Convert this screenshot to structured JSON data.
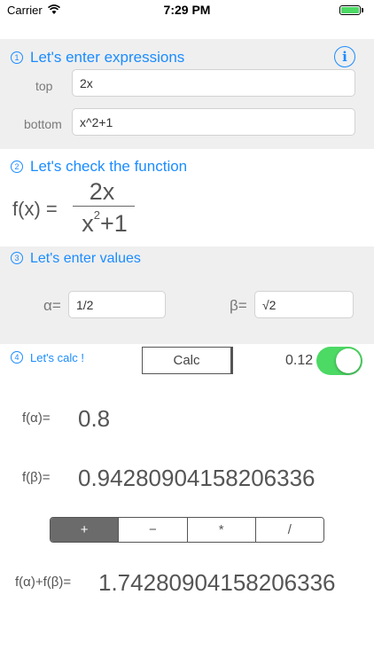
{
  "status_bar": {
    "carrier": "Carrier",
    "time": "7:29 PM"
  },
  "section1": {
    "num": "1",
    "title": "Let's enter expressions",
    "info_icon": "i",
    "top_label": "top",
    "top_value": "2x",
    "bottom_label": "bottom",
    "bottom_value": "x^2+1"
  },
  "section2": {
    "num": "2",
    "title": "Let's check the function",
    "fx_label": "f(x) =",
    "numerator": "2x",
    "denominator_base": "x",
    "denominator_exp": "2",
    "denominator_rest": "+1"
  },
  "section3": {
    "num": "3",
    "title": "Let's enter values",
    "alpha_label": "α=",
    "alpha_value": "1/2",
    "beta_label": "β=",
    "beta_value": "√2"
  },
  "section4": {
    "num": "4",
    "title": "Let's calc !",
    "calc_button": "Calc",
    "toggle_value": "0.12",
    "toggle_on": true
  },
  "results": {
    "f_alpha_label": "f(α)=",
    "f_alpha_value": "0.8",
    "f_beta_label": "f(β)=",
    "f_beta_value": "0.94280904158206336",
    "combined_label": "f(α)+f(β)=",
    "combined_value": "1.74280904158206336"
  },
  "operators": {
    "options": [
      "+",
      "−",
      "*",
      "/"
    ],
    "selected": "+"
  },
  "colors": {
    "accent": "#1a8cff",
    "toggle_on": "#4cd964",
    "section_bg": "#efefef"
  }
}
